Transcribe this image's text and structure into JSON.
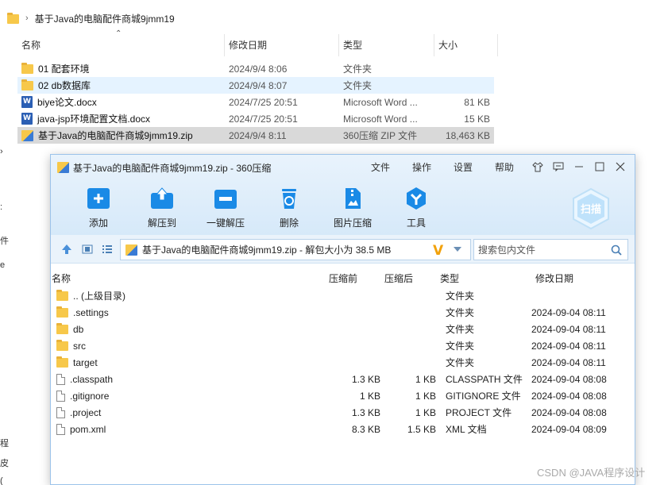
{
  "explorer": {
    "breadcrumb": "基于Java的电脑配件商城9jmm19",
    "columns": {
      "name": "名称",
      "date": "修改日期",
      "type": "类型",
      "size": "大小"
    },
    "rows": [
      {
        "name": "01 配套环境",
        "date": "2024/9/4 8:06",
        "type": "文件夹",
        "size": "",
        "icon": "folder-icon"
      },
      {
        "name": "02 db数据库",
        "date": "2024/9/4 8:07",
        "type": "文件夹",
        "size": "",
        "icon": "folder-icon"
      },
      {
        "name": "biye论文.docx",
        "date": "2024/7/25 20:51",
        "type": "Microsoft Word ...",
        "size": "81 KB",
        "icon": "word-doc-icon"
      },
      {
        "name": "java-jsp环境配置文档.docx",
        "date": "2024/7/25 20:51",
        "type": "Microsoft Word ...",
        "size": "15 KB",
        "icon": "word-doc-icon"
      },
      {
        "name": "基于Java的电脑配件商城9jmm19.zip",
        "date": "2024/9/4 8:11",
        "type": "360压缩 ZIP 文件",
        "size": "18,463 KB",
        "icon": "zip-archive-icon"
      }
    ],
    "edge_chars": [
      "件",
      "e",
      "程",
      "皮",
      "("
    ]
  },
  "zip_window": {
    "title": "基于Java的电脑配件商城9jmm19.zip - 360压缩",
    "menu": [
      "文件",
      "操作",
      "设置",
      "帮助"
    ],
    "toolbar": [
      "添加",
      "解压到",
      "一键解压",
      "删除",
      "图片压缩",
      "工具"
    ],
    "scan_label": "扫描",
    "path": "基于Java的电脑配件商城9jmm19.zip - 解包大小为 38.5 MB",
    "search_placeholder": "搜索包内文件",
    "columns": {
      "name": "名称",
      "csize": "压缩前",
      "osize": "压缩后",
      "type": "类型",
      "date": "修改日期"
    },
    "rows": [
      {
        "name": ".. (上级目录)",
        "csize": "",
        "osize": "",
        "type": "文件夹",
        "date": "",
        "icon": "folder-icon"
      },
      {
        "name": ".settings",
        "csize": "",
        "osize": "",
        "type": "文件夹",
        "date": "2024-09-04 08:11",
        "icon": "folder-icon"
      },
      {
        "name": "db",
        "csize": "",
        "osize": "",
        "type": "文件夹",
        "date": "2024-09-04 08:11",
        "icon": "folder-icon"
      },
      {
        "name": "src",
        "csize": "",
        "osize": "",
        "type": "文件夹",
        "date": "2024-09-04 08:11",
        "icon": "folder-icon"
      },
      {
        "name": "target",
        "csize": "",
        "osize": "",
        "type": "文件夹",
        "date": "2024-09-04 08:11",
        "icon": "folder-icon"
      },
      {
        "name": ".classpath",
        "csize": "1.3 KB",
        "osize": "1 KB",
        "type": "CLASSPATH 文件",
        "date": "2024-09-04 08:08",
        "icon": "file-icon"
      },
      {
        "name": ".gitignore",
        "csize": "1 KB",
        "osize": "1 KB",
        "type": "GITIGNORE 文件",
        "date": "2024-09-04 08:08",
        "icon": "file-icon"
      },
      {
        "name": ".project",
        "csize": "1.3 KB",
        "osize": "1 KB",
        "type": "PROJECT 文件",
        "date": "2024-09-04 08:08",
        "icon": "file-icon"
      },
      {
        "name": "pom.xml",
        "csize": "8.3 KB",
        "osize": "1.5 KB",
        "type": "XML 文档",
        "date": "2024-09-04 08:09",
        "icon": "file-icon"
      }
    ]
  },
  "watermark": "CSDN @JAVA程序设计",
  "colors": {
    "accent": "#1a8ae6",
    "folder": "#f7c84a",
    "v_mark": "#f2a20c"
  }
}
